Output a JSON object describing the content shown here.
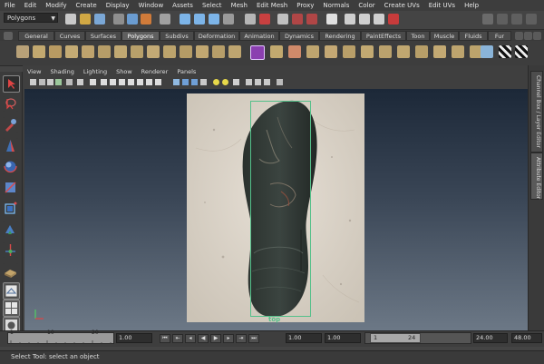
{
  "menubar": {
    "items": [
      "File",
      "Edit",
      "Modify",
      "Create",
      "Display",
      "Window",
      "Assets",
      "Select",
      "Mesh",
      "Edit Mesh",
      "Proxy",
      "Normals",
      "Color",
      "Create UVs",
      "Edit UVs",
      "Help"
    ]
  },
  "statusline": {
    "mode_value": "Polygons"
  },
  "shelf": {
    "tabs": [
      "General",
      "Curves",
      "Surfaces",
      "Polygons",
      "Subdivs",
      "Deformation",
      "Animation",
      "Dynamics",
      "Rendering",
      "PaintEffects",
      "Toon",
      "Muscle",
      "Fluids",
      "Fur"
    ],
    "active_tab": "Polygons"
  },
  "panel": {
    "menu": [
      "View",
      "Shading",
      "Lighting",
      "Show",
      "Renderer",
      "Panels"
    ],
    "camera_label": "top"
  },
  "right_tabs": {
    "channel_box": "Channel Box / Layer Editor",
    "attribute_editor": "Attribute Editor"
  },
  "timeline": {
    "ticks": [
      "1",
      "10",
      "20"
    ],
    "current_frame": "1.00",
    "range_start": "1.00",
    "range_start_inner": "1.00",
    "range_slider_start": "1",
    "range_slider_end": "24",
    "range_end_inner": "24.00",
    "range_end": "48.00"
  },
  "helpline": {
    "text": "Select Tool: select an object"
  },
  "colors": {
    "accent_green": "#55c08a",
    "viewport_top": "#1c2838",
    "viewport_bottom": "#6c7886"
  }
}
